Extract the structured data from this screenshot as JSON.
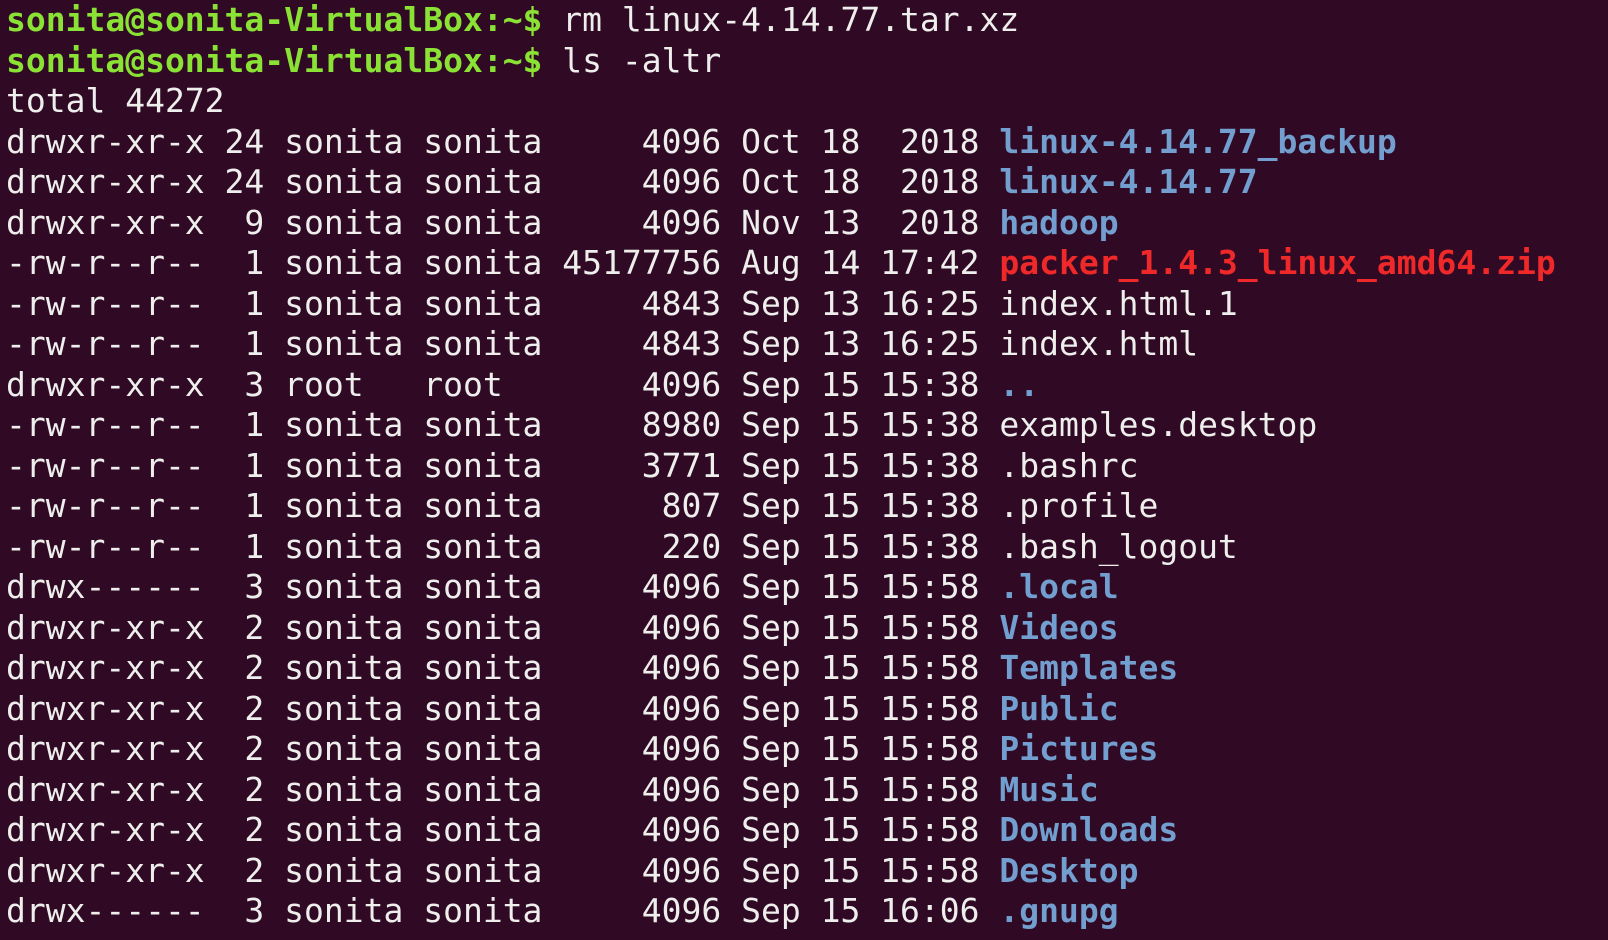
{
  "colors": {
    "background": "#300a24",
    "text": "#eeeeec",
    "prompt": "#8ae234",
    "directory": "#729fcf",
    "archive": "#ef2929"
  },
  "prompt_lines": [
    {
      "prompt": "sonita@sonita-VirtualBox:~$",
      "command": " rm linux-4.14.77.tar.xz"
    },
    {
      "prompt": "sonita@sonita-VirtualBox:~$",
      "command": " ls -altr"
    }
  ],
  "total_line": "total 44272",
  "rows": [
    {
      "meta": "drwxr-xr-x 24 sonita sonita     4096 Oct 18  2018 ",
      "name": "linux-4.14.77_backup",
      "type": "dir"
    },
    {
      "meta": "drwxr-xr-x 24 sonita sonita     4096 Oct 18  2018 ",
      "name": "linux-4.14.77",
      "type": "dir"
    },
    {
      "meta": "drwxr-xr-x  9 sonita sonita     4096 Nov 13  2018 ",
      "name": "hadoop",
      "type": "dir"
    },
    {
      "meta": "-rw-r--r--  1 sonita sonita 45177756 Aug 14 17:42 ",
      "name": "packer_1.4.3_linux_amd64.zip",
      "type": "archive"
    },
    {
      "meta": "-rw-r--r--  1 sonita sonita     4843 Sep 13 16:25 ",
      "name": "index.html.1",
      "type": "file"
    },
    {
      "meta": "-rw-r--r--  1 sonita sonita     4843 Sep 13 16:25 ",
      "name": "index.html",
      "type": "file"
    },
    {
      "meta": "drwxr-xr-x  3 root   root       4096 Sep 15 15:38 ",
      "name": "..",
      "type": "dir"
    },
    {
      "meta": "-rw-r--r--  1 sonita sonita     8980 Sep 15 15:38 ",
      "name": "examples.desktop",
      "type": "file"
    },
    {
      "meta": "-rw-r--r--  1 sonita sonita     3771 Sep 15 15:38 ",
      "name": ".bashrc",
      "type": "file"
    },
    {
      "meta": "-rw-r--r--  1 sonita sonita      807 Sep 15 15:38 ",
      "name": ".profile",
      "type": "file"
    },
    {
      "meta": "-rw-r--r--  1 sonita sonita      220 Sep 15 15:38 ",
      "name": ".bash_logout",
      "type": "file"
    },
    {
      "meta": "drwx------  3 sonita sonita     4096 Sep 15 15:58 ",
      "name": ".local",
      "type": "dir"
    },
    {
      "meta": "drwxr-xr-x  2 sonita sonita     4096 Sep 15 15:58 ",
      "name": "Videos",
      "type": "dir"
    },
    {
      "meta": "drwxr-xr-x  2 sonita sonita     4096 Sep 15 15:58 ",
      "name": "Templates",
      "type": "dir"
    },
    {
      "meta": "drwxr-xr-x  2 sonita sonita     4096 Sep 15 15:58 ",
      "name": "Public",
      "type": "dir"
    },
    {
      "meta": "drwxr-xr-x  2 sonita sonita     4096 Sep 15 15:58 ",
      "name": "Pictures",
      "type": "dir"
    },
    {
      "meta": "drwxr-xr-x  2 sonita sonita     4096 Sep 15 15:58 ",
      "name": "Music",
      "type": "dir"
    },
    {
      "meta": "drwxr-xr-x  2 sonita sonita     4096 Sep 15 15:58 ",
      "name": "Downloads",
      "type": "dir"
    },
    {
      "meta": "drwxr-xr-x  2 sonita sonita     4096 Sep 15 15:58 ",
      "name": "Desktop",
      "type": "dir"
    },
    {
      "meta": "drwx------  3 sonita sonita     4096 Sep 15 16:06 ",
      "name": ".gnupg",
      "type": "dir"
    }
  ]
}
